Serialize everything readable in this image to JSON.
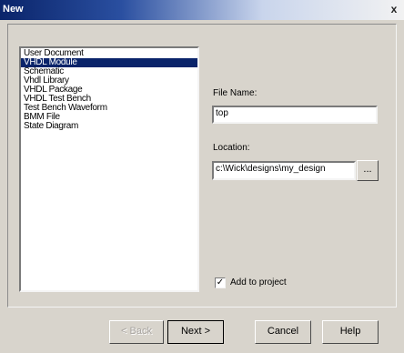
{
  "window": {
    "title": "New",
    "close_glyph": "x"
  },
  "list": {
    "items": [
      "User Document",
      "VHDL Module",
      "Schematic",
      "Vhdl Library",
      "VHDL Package",
      "VHDL Test Bench",
      "Test Bench Waveform",
      "BMM File",
      "State Diagram"
    ],
    "selected_index": 1
  },
  "form": {
    "file_name_label": "File Name:",
    "file_name_value": "top",
    "location_label": "Location:",
    "location_value": "c:\\Wick\\designs\\my_design",
    "browse_label": "...",
    "add_to_project_label": "Add to project",
    "add_to_project_checked": true,
    "check_glyph": "✓"
  },
  "buttons": {
    "back": "< Back",
    "next": "Next >",
    "cancel": "Cancel",
    "help": "Help"
  }
}
